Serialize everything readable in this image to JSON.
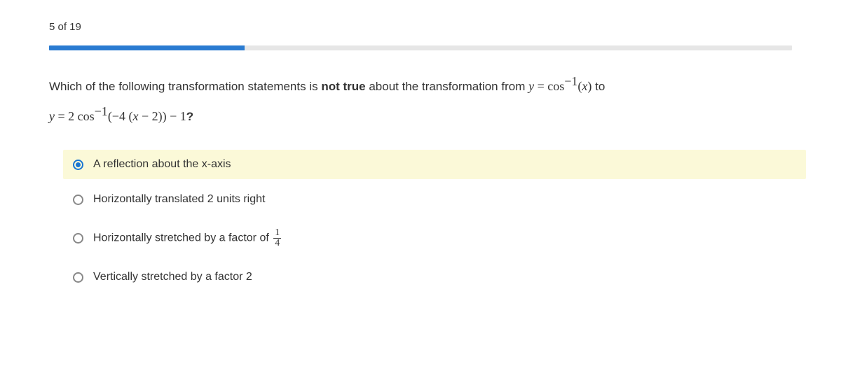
{
  "progress": {
    "label": "5 of 19",
    "current": 5,
    "total": 19
  },
  "question": {
    "prefix": "Which of the following transformation statements is ",
    "emph": "not true",
    "middle": " about the transformation from ",
    "expr1_y": "y",
    "expr1_eq": " = ",
    "expr1_cos": "cos",
    "expr1_sup": "−1",
    "expr1_open": "(",
    "expr1_x": "x",
    "expr1_close": ")",
    "to": " to",
    "expr2_y": "y",
    "expr2_eq": " = 2 ",
    "expr2_cos": "cos",
    "expr2_sup": "−1",
    "expr2_open": "(−4 (",
    "expr2_x": "x",
    "expr2_mid": " − 2)) − 1",
    "qmark": "?"
  },
  "options": [
    {
      "label": "A reflection about the x-axis",
      "selected": true,
      "frac": null
    },
    {
      "label": "Horizontally translated 2 units right",
      "selected": false,
      "frac": null
    },
    {
      "label": "Horizontally stretched by a factor of ",
      "selected": false,
      "frac": {
        "num": "1",
        "den": "4"
      }
    },
    {
      "label": "Vertically stretched by a factor 2",
      "selected": false,
      "frac": null
    }
  ]
}
